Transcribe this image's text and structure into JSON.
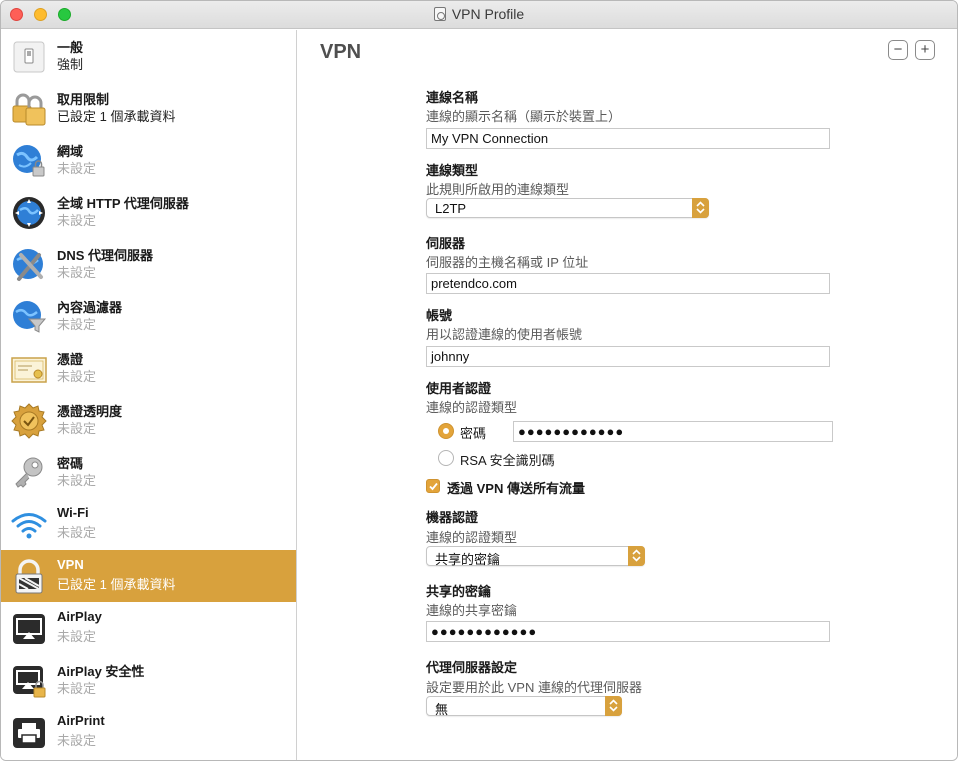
{
  "window": {
    "title": "VPN Profile"
  },
  "sidebar": {
    "items": [
      {
        "icon": "general-icon",
        "title": "一般",
        "subtitle": "強制"
      },
      {
        "icon": "restrictions-icon",
        "title": "取用限制",
        "subtitle": "已設定 1 個承載資料"
      },
      {
        "icon": "domains-icon",
        "title": "網域",
        "subtitle": "未設定"
      },
      {
        "icon": "global-http-proxy-icon",
        "title": "全域 HTTP 代理伺服器",
        "subtitle": "未設定"
      },
      {
        "icon": "dns-proxy-icon",
        "title": "DNS 代理伺服器",
        "subtitle": "未設定"
      },
      {
        "icon": "content-filter-icon",
        "title": "內容過濾器",
        "subtitle": "未設定"
      },
      {
        "icon": "certificate-icon",
        "title": "憑證",
        "subtitle": "未設定"
      },
      {
        "icon": "certificate-transparency-icon",
        "title": "憑證透明度",
        "subtitle": "未設定"
      },
      {
        "icon": "passcode-key-icon",
        "title": "密碼",
        "subtitle": "未設定"
      },
      {
        "icon": "wifi-icon",
        "title": "Wi-Fi",
        "subtitle": "未設定"
      },
      {
        "icon": "vpn-lock-icon",
        "title": "VPN",
        "subtitle": "已設定 1 個承載資料"
      },
      {
        "icon": "airplay-icon",
        "title": "AirPlay",
        "subtitle": "未設定"
      },
      {
        "icon": "airplay-security-icon",
        "title": "AirPlay 安全性",
        "subtitle": "未設定"
      },
      {
        "icon": "airprint-icon",
        "title": "AirPrint",
        "subtitle": "未設定"
      }
    ],
    "selected_index": 10
  },
  "main": {
    "title": "VPN",
    "remove_label": "−",
    "add_label": "+",
    "connection_name": {
      "label": "連線名稱",
      "description": "連線的顯示名稱（顯示於裝置上）",
      "value": "My VPN Connection"
    },
    "connection_type": {
      "label": "連線類型",
      "description": "此規則所啟用的連線類型",
      "value": "L2TP"
    },
    "server": {
      "label": "伺服器",
      "description": "伺服器的主機名稱或 IP 位址",
      "value": "pretendco.com"
    },
    "account": {
      "label": "帳號",
      "description": "用以認證連線的使用者帳號",
      "value": "johnny"
    },
    "user_auth": {
      "label": "使用者認證",
      "description": "連線的認證類型",
      "password_option": "密碼",
      "password_value": "●●●●●●●●●●●●",
      "rsa_option": "RSA 安全識別碼",
      "selected": "密碼"
    },
    "send_all_traffic": {
      "label": "透過 VPN 傳送所有流量",
      "checked": true
    },
    "machine_auth": {
      "label": "機器認證",
      "description": "連線的認證類型",
      "value": "共享的密鑰"
    },
    "shared_secret": {
      "label": "共享的密鑰",
      "description": "連線的共享密鑰",
      "value": "●●●●●●●●●●●●"
    },
    "proxy": {
      "label": "代理伺服器設定",
      "description": "設定要用於此 VPN 連線的代理伺服器",
      "value": "無"
    }
  },
  "colors": {
    "accent": "#d8a13d",
    "selection": "#d8a13d"
  }
}
